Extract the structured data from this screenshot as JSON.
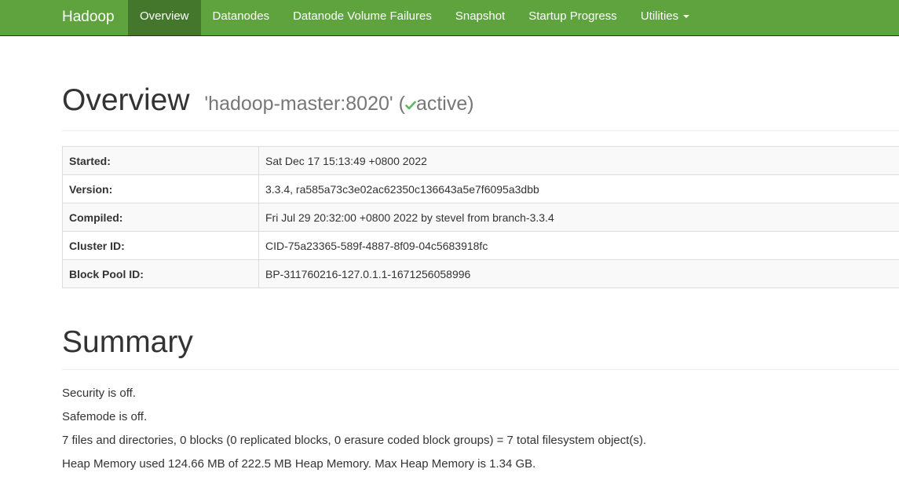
{
  "navbar": {
    "brand": "Hadoop",
    "items": [
      {
        "label": "Overview",
        "active": true
      },
      {
        "label": "Datanodes"
      },
      {
        "label": "Datanode Volume Failures"
      },
      {
        "label": "Snapshot"
      },
      {
        "label": "Startup Progress"
      },
      {
        "label": "Utilities",
        "dropdown": true
      }
    ]
  },
  "overview": {
    "title": "Overview",
    "host": "'hadoop-master:8020'",
    "paren_open": "(",
    "status": "active",
    "paren_close": ")",
    "status_icon": "check-icon",
    "status_icon_color": "#5cb85c"
  },
  "info_table": [
    {
      "label": "Started:",
      "value": "Sat Dec 17 15:13:49 +0800 2022"
    },
    {
      "label": "Version:",
      "value": "3.3.4, ra585a73c3e02ac62350c136643a5e7f6095a3dbb"
    },
    {
      "label": "Compiled:",
      "value": "Fri Jul 29 20:32:00 +0800 2022 by stevel from branch-3.3.4"
    },
    {
      "label": "Cluster ID:",
      "value": "CID-75a23365-589f-4887-8f09-04c5683918fc"
    },
    {
      "label": "Block Pool ID:",
      "value": "BP-311760216-127.0.1.1-1671256058996"
    }
  ],
  "summary": {
    "title": "Summary",
    "lines": [
      "Security is off.",
      "Safemode is off.",
      "7 files and directories, 0 blocks (0 replicated blocks, 0 erasure coded block groups) = 7 total filesystem object(s).",
      "Heap Memory used 124.66 MB of 222.5 MB Heap Memory. Max Heap Memory is 1.34 GB."
    ]
  },
  "colors": {
    "navbar_bg": "#5fa33e",
    "navbar_active_bg": "#44762b",
    "text": "#333333"
  }
}
